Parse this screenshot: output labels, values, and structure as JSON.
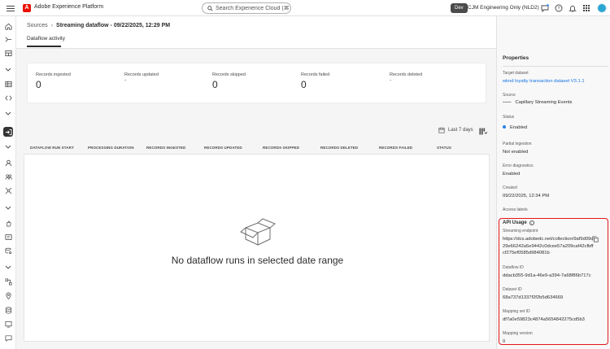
{
  "header": {
    "app_title": "Adobe Experience Platform",
    "search_placeholder": "Search Experience Cloud (⌘+/)",
    "env_badge": "Dev",
    "org_name": "CJM Engineering Only (NLD2)"
  },
  "breadcrumb": {
    "root": "Sources",
    "separator": "›",
    "current": "Streaming dataflow - 09/22/2025, 12:29 PM"
  },
  "tabs": [
    {
      "label": "Dataflow activity",
      "selected": true
    }
  ],
  "metrics": [
    {
      "label": "Records ingested",
      "value": "0"
    },
    {
      "label": "Records updated",
      "value": "-"
    },
    {
      "label": "Records skipped",
      "value": "0"
    },
    {
      "label": "Records failed",
      "value": "0"
    },
    {
      "label": "Records deleted",
      "value": "-"
    }
  ],
  "toolbar": {
    "date_range": "Last 7 days"
  },
  "table": {
    "columns": [
      "DATAFLOW RUN START",
      "PROCESSING DURATION",
      "RECORDS INGESTED",
      "RECORDS UPDATED",
      "RECORDS SKIPPED",
      "RECORDS DELETED",
      "RECORDS FAILED",
      "STATUS"
    ],
    "rows": [],
    "empty_message": "No dataflow runs in selected date range"
  },
  "properties": {
    "title": "Properties",
    "target_dataset_label": "Target dataset",
    "target_dataset_value": "wknd loyalty transaction dataset V3.1.1",
    "source_label": "Source",
    "source_value": "Capillary Streaming Events",
    "status_label": "Status",
    "status_value": "Enabled",
    "partial_ingestion_label": "Partial ingestion",
    "partial_ingestion_value": "Not enabled",
    "error_diagnostics_label": "Error diagnostics",
    "error_diagnostics_value": "Enabled",
    "created_label": "Created",
    "created_value": "09/22/2025, 12:34 PM",
    "access_labels_label": "Access labels"
  },
  "api_usage": {
    "title": "API Usage",
    "streaming_endpoint_label": "Streaming endpoint",
    "streaming_endpoint_value": "https://dcs.adobedc.net/collection/9af9d09d29e66242a5e9442c0dcee57a209caf42cfbffcf275ef0585d984081b",
    "dataflow_id_label": "Dataflow ID",
    "dataflow_id_value": "ddacb355-9d1a-46e9-a394-7a68f86b717c",
    "dataset_id_label": "Dataset ID",
    "dataset_id_value": "68a737d1337f2f2b5d634669",
    "mapping_set_id_label": "Mapping set ID",
    "mapping_set_id_value": "df7a0e59823c4874a5654842275cd5b3",
    "mapping_version_label": "Mapping version",
    "mapping_version_value": "0"
  },
  "colors": {
    "accent_link": "#1473e6",
    "status_dot": "#2680eb",
    "highlight_border": "#e3151b",
    "brand": "#eb1000"
  }
}
